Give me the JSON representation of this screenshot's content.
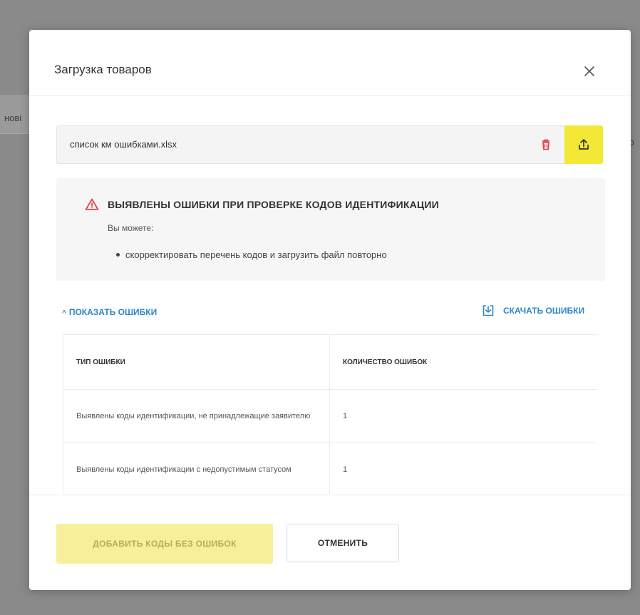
{
  "background": {
    "left_fragment": "нові",
    "right_fragment": "ю"
  },
  "modal": {
    "title": "Загрузка товаров",
    "close_icon": "close-icon"
  },
  "file": {
    "name": "список км ошибками.xlsx",
    "delete_icon": "trash-icon",
    "upload_icon": "upload-icon"
  },
  "alert": {
    "icon": "warning-triangle-icon",
    "title": "ВЫЯВЛЕНЫ ОШИБКИ ПРИ ПРОВЕРКЕ КОДОВ ИДЕНТИФИКАЦИИ",
    "subtitle": "Вы можете:",
    "bullets": [
      "скорректировать перечень кодов и загрузить файл повторно"
    ]
  },
  "errors": {
    "toggle_label": "ПОКАЗАТЬ ОШИБКИ",
    "download_label": "СКАЧАТЬ ОШИБКИ",
    "table": {
      "headers": [
        "ТИП ОШИБКИ",
        "КОЛИЧЕСТВО ОШИБОК"
      ],
      "rows": [
        [
          "Выявлены коды идентификации, не принадлежащие заявителю",
          "1"
        ],
        [
          "Выявлены коды идентификации с недопустимым статусом",
          "1"
        ]
      ]
    }
  },
  "footer": {
    "primary_label": "ДОБАВИТЬ КОДЫ БЕЗ ОШИБОК",
    "secondary_label": "ОТМЕНИТЬ"
  },
  "colors": {
    "accent_yellow": "#f4e836",
    "disabled_yellow": "#f7ef9a",
    "link_blue": "#2f86c6",
    "error_red": "#e04848"
  }
}
